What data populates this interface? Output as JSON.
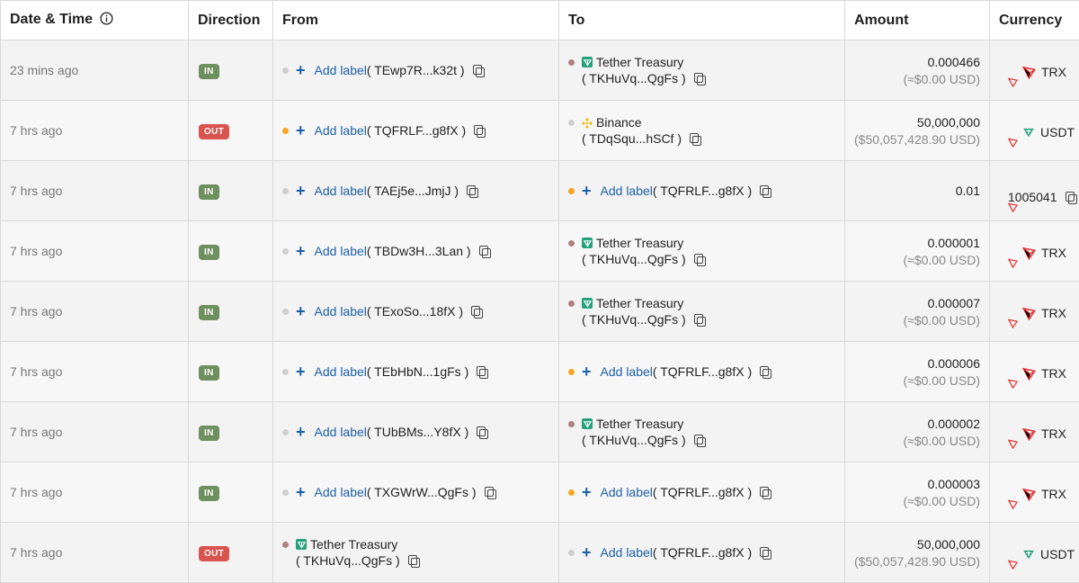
{
  "headers": {
    "datetime": "Date & Time",
    "direction": "Direction",
    "from": "From",
    "to": "To",
    "amount": "Amount",
    "currency": "Currency"
  },
  "colors": {
    "in_badge": "#6e8f5e",
    "out_badge": "#d9534f",
    "link": "#1c5fa6",
    "dot_gray": "#cfcfcf",
    "dot_orange": "#f5a623",
    "dot_rose": "#b08080",
    "tron_red": "#e03131",
    "tether_green": "#26a17b"
  },
  "rows": [
    {
      "time": "23 mins ago",
      "direction": "IN",
      "from": {
        "type": "label",
        "dot": "gray",
        "add": "Add label",
        "addr": "( TEwp7R...k32t )"
      },
      "to": {
        "type": "named",
        "dot": "rose",
        "icon": "tether-icon",
        "name": "Tether Treasury",
        "addr": "( TKHuVq...QgFs )"
      },
      "amount": "0.000466",
      "usd": "(≈$0.00 USD)",
      "currency": {
        "icon": "tron-icon",
        "symbol": "TRX"
      }
    },
    {
      "time": "7 hrs ago",
      "direction": "OUT",
      "from": {
        "type": "label",
        "dot": "orange",
        "add": "Add label",
        "addr": "( TQFRLF...g8fX )"
      },
      "to": {
        "type": "named",
        "dot": "gray",
        "icon": "binance-icon",
        "name": "Binance",
        "addr": "( TDqSqu...hSCf )"
      },
      "amount": "50,000,000",
      "usd": "($50,057,428.90 USD)",
      "currency": {
        "icon": "tether-icon",
        "symbol": "USDT"
      }
    },
    {
      "time": "7 hrs ago",
      "direction": "IN",
      "from": {
        "type": "label",
        "dot": "gray",
        "add": "Add label",
        "addr": "( TAEj5e...JmjJ )"
      },
      "to": {
        "type": "label",
        "dot": "orange",
        "add": "Add label",
        "addr": "( TQFRLF...g8fX )"
      },
      "amount": "0.01",
      "usd": "",
      "currency": {
        "icon": "none",
        "symbol": "1005041"
      }
    },
    {
      "time": "7 hrs ago",
      "direction": "IN",
      "from": {
        "type": "label",
        "dot": "gray",
        "add": "Add label",
        "addr": "( TBDw3H...3Lan )"
      },
      "to": {
        "type": "named",
        "dot": "rose",
        "icon": "tether-icon",
        "name": "Tether Treasury",
        "addr": "( TKHuVq...QgFs )"
      },
      "amount": "0.000001",
      "usd": "(≈$0.00 USD)",
      "currency": {
        "icon": "tron-icon",
        "symbol": "TRX"
      }
    },
    {
      "time": "7 hrs ago",
      "direction": "IN",
      "from": {
        "type": "label",
        "dot": "gray",
        "add": "Add label",
        "addr": "( TExoSo...18fX )"
      },
      "to": {
        "type": "named",
        "dot": "rose",
        "icon": "tether-icon",
        "name": "Tether Treasury",
        "addr": "( TKHuVq...QgFs )"
      },
      "amount": "0.000007",
      "usd": "(≈$0.00 USD)",
      "currency": {
        "icon": "tron-icon",
        "symbol": "TRX"
      }
    },
    {
      "time": "7 hrs ago",
      "direction": "IN",
      "from": {
        "type": "label",
        "dot": "gray",
        "add": "Add label",
        "addr": "( TEbHbN...1gFs )"
      },
      "to": {
        "type": "label",
        "dot": "orange",
        "add": "Add label",
        "addr": "( TQFRLF...g8fX )"
      },
      "amount": "0.000006",
      "usd": "(≈$0.00 USD)",
      "currency": {
        "icon": "tron-icon",
        "symbol": "TRX"
      }
    },
    {
      "time": "7 hrs ago",
      "direction": "IN",
      "from": {
        "type": "label",
        "dot": "gray",
        "add": "Add label",
        "addr": "( TUbBMs...Y8fX )"
      },
      "to": {
        "type": "named",
        "dot": "rose",
        "icon": "tether-icon",
        "name": "Tether Treasury",
        "addr": "( TKHuVq...QgFs )"
      },
      "amount": "0.000002",
      "usd": "(≈$0.00 USD)",
      "currency": {
        "icon": "tron-icon",
        "symbol": "TRX"
      }
    },
    {
      "time": "7 hrs ago",
      "direction": "IN",
      "from": {
        "type": "label",
        "dot": "gray",
        "add": "Add label",
        "addr": "( TXGWrW...QgFs )"
      },
      "to": {
        "type": "label",
        "dot": "orange",
        "add": "Add label",
        "addr": "( TQFRLF...g8fX )"
      },
      "amount": "0.000003",
      "usd": "(≈$0.00 USD)",
      "currency": {
        "icon": "tron-icon",
        "symbol": "TRX"
      }
    },
    {
      "time": "7 hrs ago",
      "direction": "OUT",
      "from": {
        "type": "named",
        "dot": "rose",
        "icon": "tether-icon",
        "name": "Tether Treasury",
        "addr": "( TKHuVq...QgFs )"
      },
      "to": {
        "type": "label",
        "dot": "gray",
        "add": "Add label",
        "addr": "( TQFRLF...g8fX )"
      },
      "amount": "50,000,000",
      "usd": "($50,057,428.90 USD)",
      "currency": {
        "icon": "tether-icon",
        "symbol": "USDT"
      }
    }
  ]
}
